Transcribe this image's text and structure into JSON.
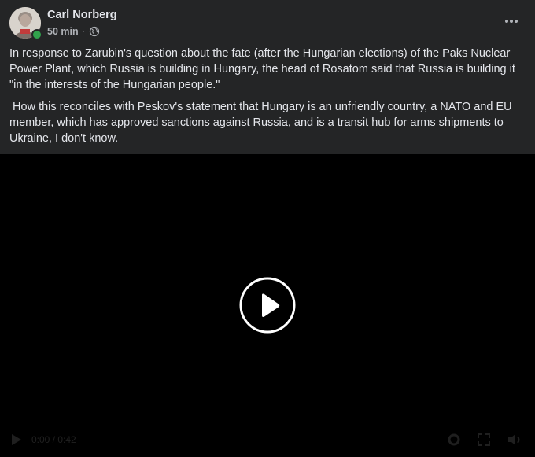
{
  "post": {
    "author": "Carl Norberg",
    "time": "50 min",
    "separator": "·",
    "privacy_icon": "globe-icon",
    "online_status_color": "#31a24c",
    "paragraphs": [
      "In response to Zarubin's question about the fate (after the Hungarian elections) of the Paks Nuclear Power Plant, which Russia is building in Hungary, the head of Rosatom said that Russia is building it \"in the interests of the Hungarian people.\"",
      " How this reconciles with Peskov's statement that Hungary is an unfriendly country, a NATO and EU member, which has approved sanctions against Russia, and is a transit hub for arms shipments to Ukraine, I don't know."
    ]
  },
  "video": {
    "center_icon": "play-circle-icon",
    "controls": {
      "icons": [
        "play-icon",
        "volume-icon",
        "settings-icon",
        "fullscreen-icon",
        "pip-icon"
      ],
      "time": "0:00 / 0:42"
    }
  },
  "colors": {
    "background": "#242526",
    "text": "#e4e6eb",
    "secondary_text": "#b0b3b8",
    "video_background": "#000000"
  }
}
